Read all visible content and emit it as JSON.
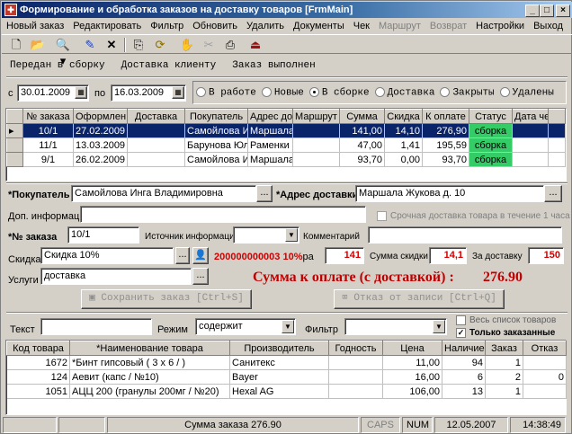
{
  "window": {
    "title": "Формирование и обработка заказов на доставку товаров [FrmMain]"
  },
  "menu": [
    {
      "label": "Новый заказ",
      "enabled": true
    },
    {
      "label": "Редактировать",
      "enabled": true
    },
    {
      "label": "Фильтр",
      "enabled": true
    },
    {
      "label": "Обновить",
      "enabled": true
    },
    {
      "label": "Удалить",
      "enabled": true
    },
    {
      "label": "Документы",
      "enabled": true
    },
    {
      "label": "Чек",
      "enabled": true
    },
    {
      "label": "Маршрут",
      "enabled": false
    },
    {
      "label": "Возврат",
      "enabled": false
    },
    {
      "label": "Настройки",
      "enabled": true
    },
    {
      "label": "Выход",
      "enabled": true
    }
  ],
  "tabs": [
    "Передан в сборку",
    "Доставка клиенту",
    "Заказ выполнен"
  ],
  "dates": {
    "from_label": "с",
    "from": "30.01.2009",
    "to_label": "по",
    "to": "16.03.2009"
  },
  "status_filter": [
    {
      "label": "В работе",
      "checked": false
    },
    {
      "label": "Новые",
      "checked": false
    },
    {
      "label": "В сборке",
      "checked": true
    },
    {
      "label": "Доставка",
      "checked": false
    },
    {
      "label": "Закрыты",
      "checked": false
    },
    {
      "label": "Удалены",
      "checked": false
    }
  ],
  "orders": {
    "columns": [
      "№ заказа",
      "Оформлен",
      "Доставка",
      "Покупатель",
      "Адрес до",
      "Маршрут",
      "Сумма",
      "Скидка",
      "К оплате",
      "Статус",
      "Дата чека"
    ],
    "rows": [
      {
        "no": "10/1",
        "date": "27.02.2009",
        "delivery": "",
        "buyer": "Самойлова Ин",
        "address": "Маршала",
        "route": "",
        "sum": "141,00",
        "discount": "14,10",
        "pay": "276,90",
        "status": "сборка",
        "check_date": "",
        "selected": true
      },
      {
        "no": "11/1",
        "date": "13.03.2009",
        "delivery": "",
        "buyer": "Барунова Юля",
        "address": "Раменки",
        "route": "",
        "sum": "47,00",
        "discount": "1,41",
        "pay": "195,59",
        "status": "сборка",
        "check_date": "",
        "selected": false
      },
      {
        "no": "9/1",
        "date": "26.02.2009",
        "delivery": "",
        "buyer": "Самойлова Ин",
        "address": "Маршала",
        "route": "",
        "sum": "93,70",
        "discount": "0,00",
        "pay": "93,70",
        "status": "сборка",
        "check_date": "",
        "selected": false
      }
    ]
  },
  "form": {
    "buyer_label": "*Покупатель",
    "buyer": "Самойлова Инга Владимировна",
    "address_label": "*Адрес доставки",
    "address": "Маршала Жукова д. 10",
    "extra_label": "Доп. информация",
    "extra": "",
    "urgent_label": "Срочная доставка товара в течение 1 часа",
    "order_no_label": "*№ заказа",
    "order_no": "10/1",
    "source_label": "Источник информации",
    "source": "",
    "comment_label": "Комментарий",
    "comment": "",
    "discount_label": "Скидка",
    "discount": "Скидка 10%",
    "card_no": "200000000003",
    "card_pct": "10%",
    "card_suffix": "ра",
    "amount": "141",
    "discount_sum_label": "Сумма скидки",
    "discount_sum": "14,1",
    "delivery_label": "За доставку",
    "delivery": "150",
    "services_label": "Услуги",
    "services": "доставка",
    "total_label": "Сумма к оплате (с доставкой) :",
    "total": "276.90",
    "save_button": "Сохранить заказ [Ctrl+S]",
    "cancel_button": "Отказ от записи [Ctrl+Q]"
  },
  "search": {
    "text_label": "Текст",
    "text": "",
    "mode_label": "Режим",
    "mode": "содержит",
    "filter_label": "Фильтр",
    "filter": "",
    "all_goods_label": "Весь список товаров",
    "all_goods_checked": false,
    "ordered_only_label": "Только заказанные",
    "ordered_only_checked": true
  },
  "goods": {
    "columns": [
      "Код товара",
      "*Наименование товара",
      "Производитель",
      "Годность",
      "Цена",
      "Наличие",
      "Заказ",
      "Отказ"
    ],
    "rows": [
      {
        "code": "1672",
        "name": "*Бинт гипсовый ( 3 x 6 / )",
        "maker": "Санитекс",
        "expiry": "",
        "price": "11,00",
        "stock": "94",
        "order": "1",
        "refuse": ""
      },
      {
        "code": "124",
        "name": "Аевит (капс  / №10)",
        "maker": "Bayer",
        "expiry": "",
        "price": "16,00",
        "stock": "6",
        "order": "2",
        "refuse": "0"
      },
      {
        "code": "1051",
        "name": "АЦЦ 200 (гранулы 200мг / №20)",
        "maker": "Hexal AG",
        "expiry": "",
        "price": "106,00",
        "stock": "13",
        "order": "1",
        "refuse": ""
      }
    ]
  },
  "statusbar": {
    "order_sum": "Сумма заказа 276.90",
    "caps": "CAPS",
    "num": "NUM",
    "date": "12.05.2007",
    "time": "14:38:49"
  }
}
